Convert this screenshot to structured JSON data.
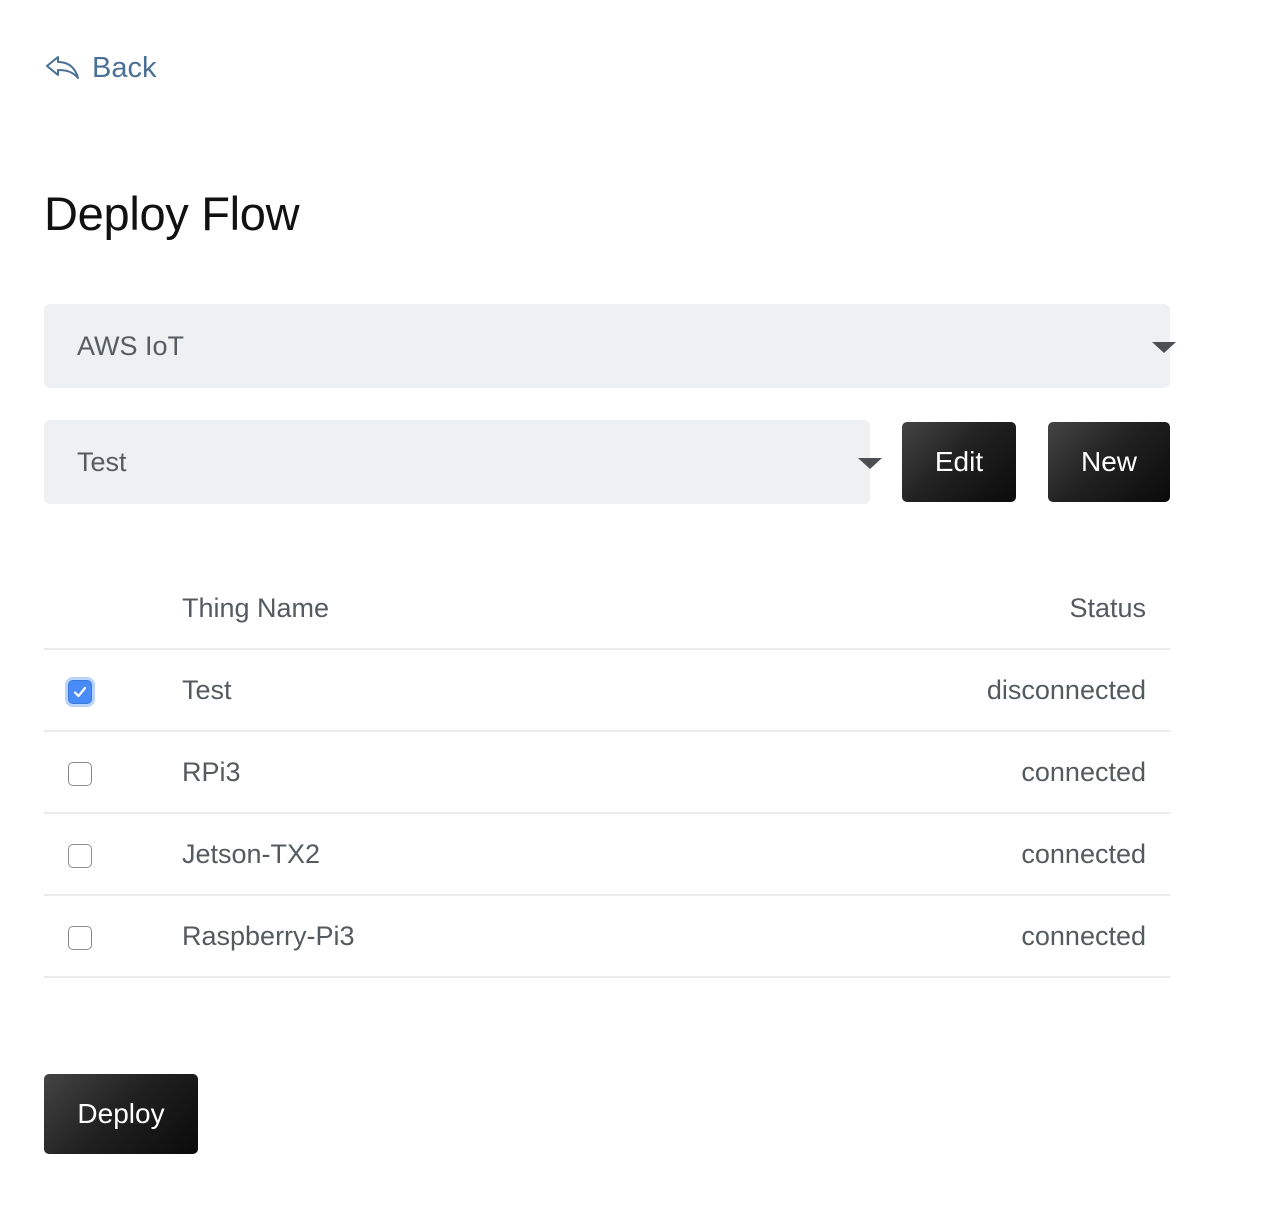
{
  "nav": {
    "back_label": "Back"
  },
  "page": {
    "title": "Deploy Flow"
  },
  "selects": {
    "provider": {
      "value": "AWS IoT"
    },
    "group": {
      "value": "Test"
    }
  },
  "buttons": {
    "edit_label": "Edit",
    "new_label": "New",
    "deploy_label": "Deploy"
  },
  "table": {
    "headers": {
      "name": "Thing Name",
      "status": "Status"
    },
    "rows": [
      {
        "name": "Test",
        "status": "disconnected",
        "checked": true
      },
      {
        "name": "RPi3",
        "status": "connected",
        "checked": false
      },
      {
        "name": "Jetson-TX2",
        "status": "connected",
        "checked": false
      },
      {
        "name": "Raspberry-Pi3",
        "status": "connected",
        "checked": false
      }
    ]
  },
  "colors": {
    "link": "#4a7096",
    "select_bg": "#eff0f1",
    "button_bg": "#1a1a1a",
    "checkbox_checked": "#4a8cf7"
  },
  "icons": {
    "back": "reply-arrow-icon",
    "dropdown": "caret-down-icon",
    "check": "check-icon"
  }
}
